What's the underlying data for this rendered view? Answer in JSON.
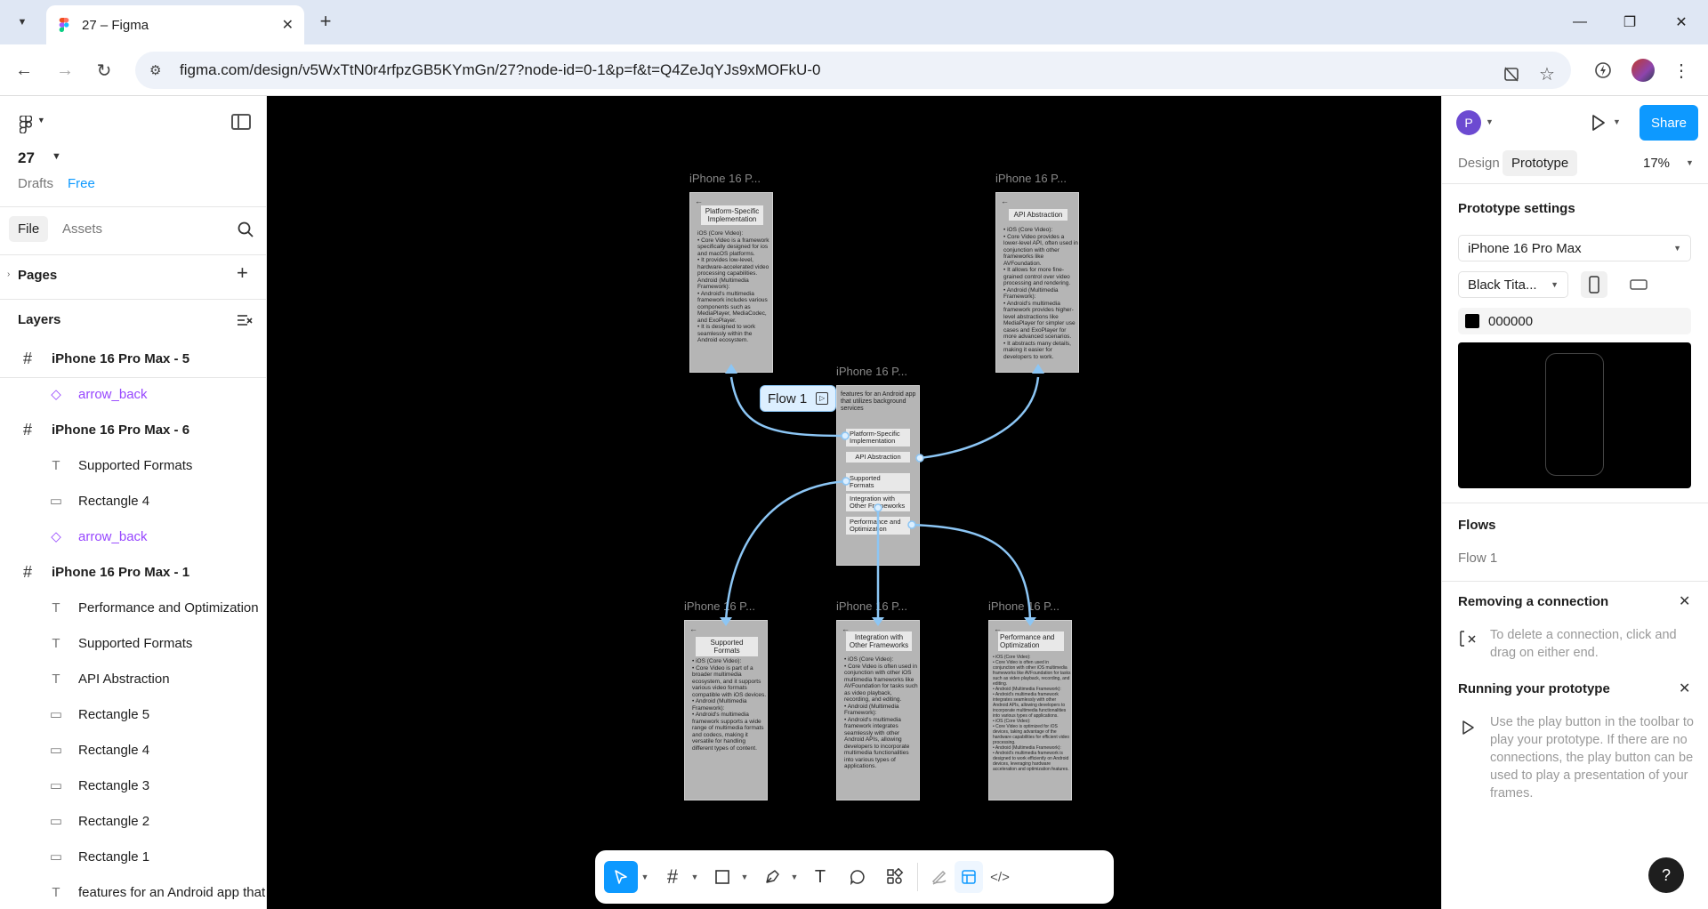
{
  "browser": {
    "tab_title": "27 – Figma",
    "url": "figma.com/design/v5WxTtN0r4rfpzGB5KYmGn/27?node-id=0-1&p=f&t=Q4ZeJqYJs9xMOFkU-0"
  },
  "left_panel": {
    "file_name": "27",
    "drafts": "Drafts",
    "plan": "Free",
    "tab_file": "File",
    "tab_assets": "Assets",
    "pages": "Pages",
    "layers": "Layers",
    "layer_items": [
      {
        "label": "iPhone 16 Pro Max - 5",
        "kind": "frame"
      },
      {
        "label": "arrow_back",
        "kind": "component"
      },
      {
        "label": "iPhone 16 Pro Max - 6",
        "kind": "frame"
      },
      {
        "label": "Supported Formats",
        "kind": "text"
      },
      {
        "label": "Rectangle 4",
        "kind": "rect"
      },
      {
        "label": "arrow_back",
        "kind": "component"
      },
      {
        "label": "iPhone 16 Pro Max - 1",
        "kind": "frame"
      },
      {
        "label": "Performance and Optimization",
        "kind": "text"
      },
      {
        "label": "Supported Formats",
        "kind": "text"
      },
      {
        "label": "API Abstraction",
        "kind": "text"
      },
      {
        "label": "Rectangle 5",
        "kind": "rect"
      },
      {
        "label": "Rectangle 4",
        "kind": "rect"
      },
      {
        "label": "Rectangle 3",
        "kind": "rect"
      },
      {
        "label": "Rectangle 2",
        "kind": "rect"
      },
      {
        "label": "Rectangle 1",
        "kind": "rect"
      },
      {
        "label": "features for an Android app that u",
        "kind": "text"
      }
    ]
  },
  "canvas": {
    "frame_label_short": "iPhone 16 P...",
    "flow_chip": "Flow 1",
    "main_frame": {
      "intro": "features for an Android app that utilizes background services",
      "buttons": [
        "Platform-Specific Implementation",
        "API Abstraction",
        "Supported Formats",
        "Integration with Other Frameworks",
        "Performance and Optimization"
      ]
    },
    "screens": {
      "platform": {
        "header": "Platform-Specific Implementation",
        "body": "iOS (Core Video):\n• Core Video is a framework specifically designed for ios and macOS platforms.\n• It provides low-level, hardware-accelerated video processing capabilities.\nAndroid (Multimedia Framework):\n• Android's multimedia framework includes various components such as MediaPlayer, MediaCodec, and ExoPlayer.\n• It is designed to work seamlessly within the Android ecosystem."
      },
      "api": {
        "header": "API Abstraction",
        "body": "• iOS (Core Video):\n• Core Video provides a lower-level API, often used in conjunction with other frameworks like AVFoundation.\n• It allows for more fine-grained control over video processing and rendering.\n• Android (Multimedia Framework):\n• Android's multimedia framework provides higher-level abstractions like MediaPlayer for simpler use cases and ExoPlayer for more advanced scenarios.\n• It abstracts many details, making it easier for developers to work."
      },
      "formats": {
        "header": "Supported Formats",
        "body": "• iOS (Core Video):\n• Core Video is part of a broader multimedia ecosystem, and it supports various video formats compatible with iOS devices.\n• Android (Multimedia Framework):\n• Android's multimedia framework supports a wide range of multimedia formats and codecs, making it versatile for handling different types of content."
      },
      "integration": {
        "header": "Integration with Other Frameworks",
        "body": "• iOS (Core Video):\n• Core Video is often used in conjunction with other iOS multimedia frameworks like AVFoundation for tasks such as video playback, recording, and editing.\n• Android (Multimedia Framework):\n• Android's multimedia framework integrates seamlessly with other Android APIs, allowing developers to incorporate multimedia functionalities into various types of applications."
      },
      "performance": {
        "header": "Performance and Optimization",
        "body": "• iOS (Core Video):\n• Core Video is often used in conjunction with other iOS multimedia frameworks like AVFoundation for tasks such as video playback, recording, and editing.\n• Android (Multimedia Framework):\n• Android's multimedia framework integrates seamlessly with other Android APIs, allowing developers to incorporate multimedia functionalities into various types of applications.\n• iOS (Core Video):\n• Core Video is optimized for iOS devices, taking advantage of the hardware capabilities for efficient video processing.\n• Android (Multimedia Framework):\n• Android's multimedia framework is designed to work efficiently on Android devices, leveraging hardware acceleration and optimization features."
      }
    }
  },
  "right_panel": {
    "avatar_initial": "P",
    "share": "Share",
    "tab_design": "Design",
    "tab_prototype": "Prototype",
    "zoom": "17%",
    "prototype_settings": "Prototype settings",
    "device": "iPhone 16 Pro Max",
    "model_color": "Black Tita...",
    "background_hex": "000000",
    "flows_heading": "Flows",
    "flow_name": "Flow 1",
    "removing_heading": "Removing a connection",
    "removing_text": "To delete a connection, click and drag on either end.",
    "running_heading": "Running your prototype",
    "running_text": "Use the play button in the toolbar to play your prototype. If there are no connections, the play button can be used to play a presentation of your frames.",
    "help": "?"
  },
  "colors": {
    "accent": "#0d99ff",
    "component": "#9747ff",
    "connector": "#8cc6f5",
    "canvas": "#000000"
  }
}
